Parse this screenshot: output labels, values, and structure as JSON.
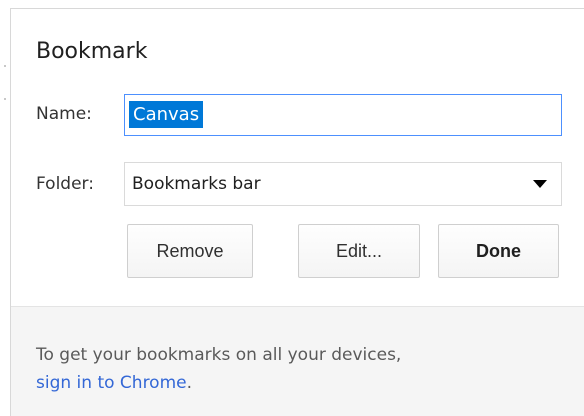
{
  "dialog": {
    "title": "Bookmark",
    "name_label": "Name:",
    "name_value": "Canvas",
    "folder_label": "Folder:",
    "folder_value": "Bookmarks bar",
    "buttons": {
      "remove": "Remove",
      "edit": "Edit...",
      "done": "Done"
    },
    "footer": {
      "text": "To get your bookmarks on all your devices,",
      "link": "sign in to Chrome",
      "link_suffix": "."
    }
  },
  "colors": {
    "accent": "#4d90fe",
    "selection": "#0078d7",
    "link": "#3367d6",
    "footer_bg": "#f5f5f5"
  },
  "icons": {
    "folder_dropdown": "chevron-down-icon"
  }
}
